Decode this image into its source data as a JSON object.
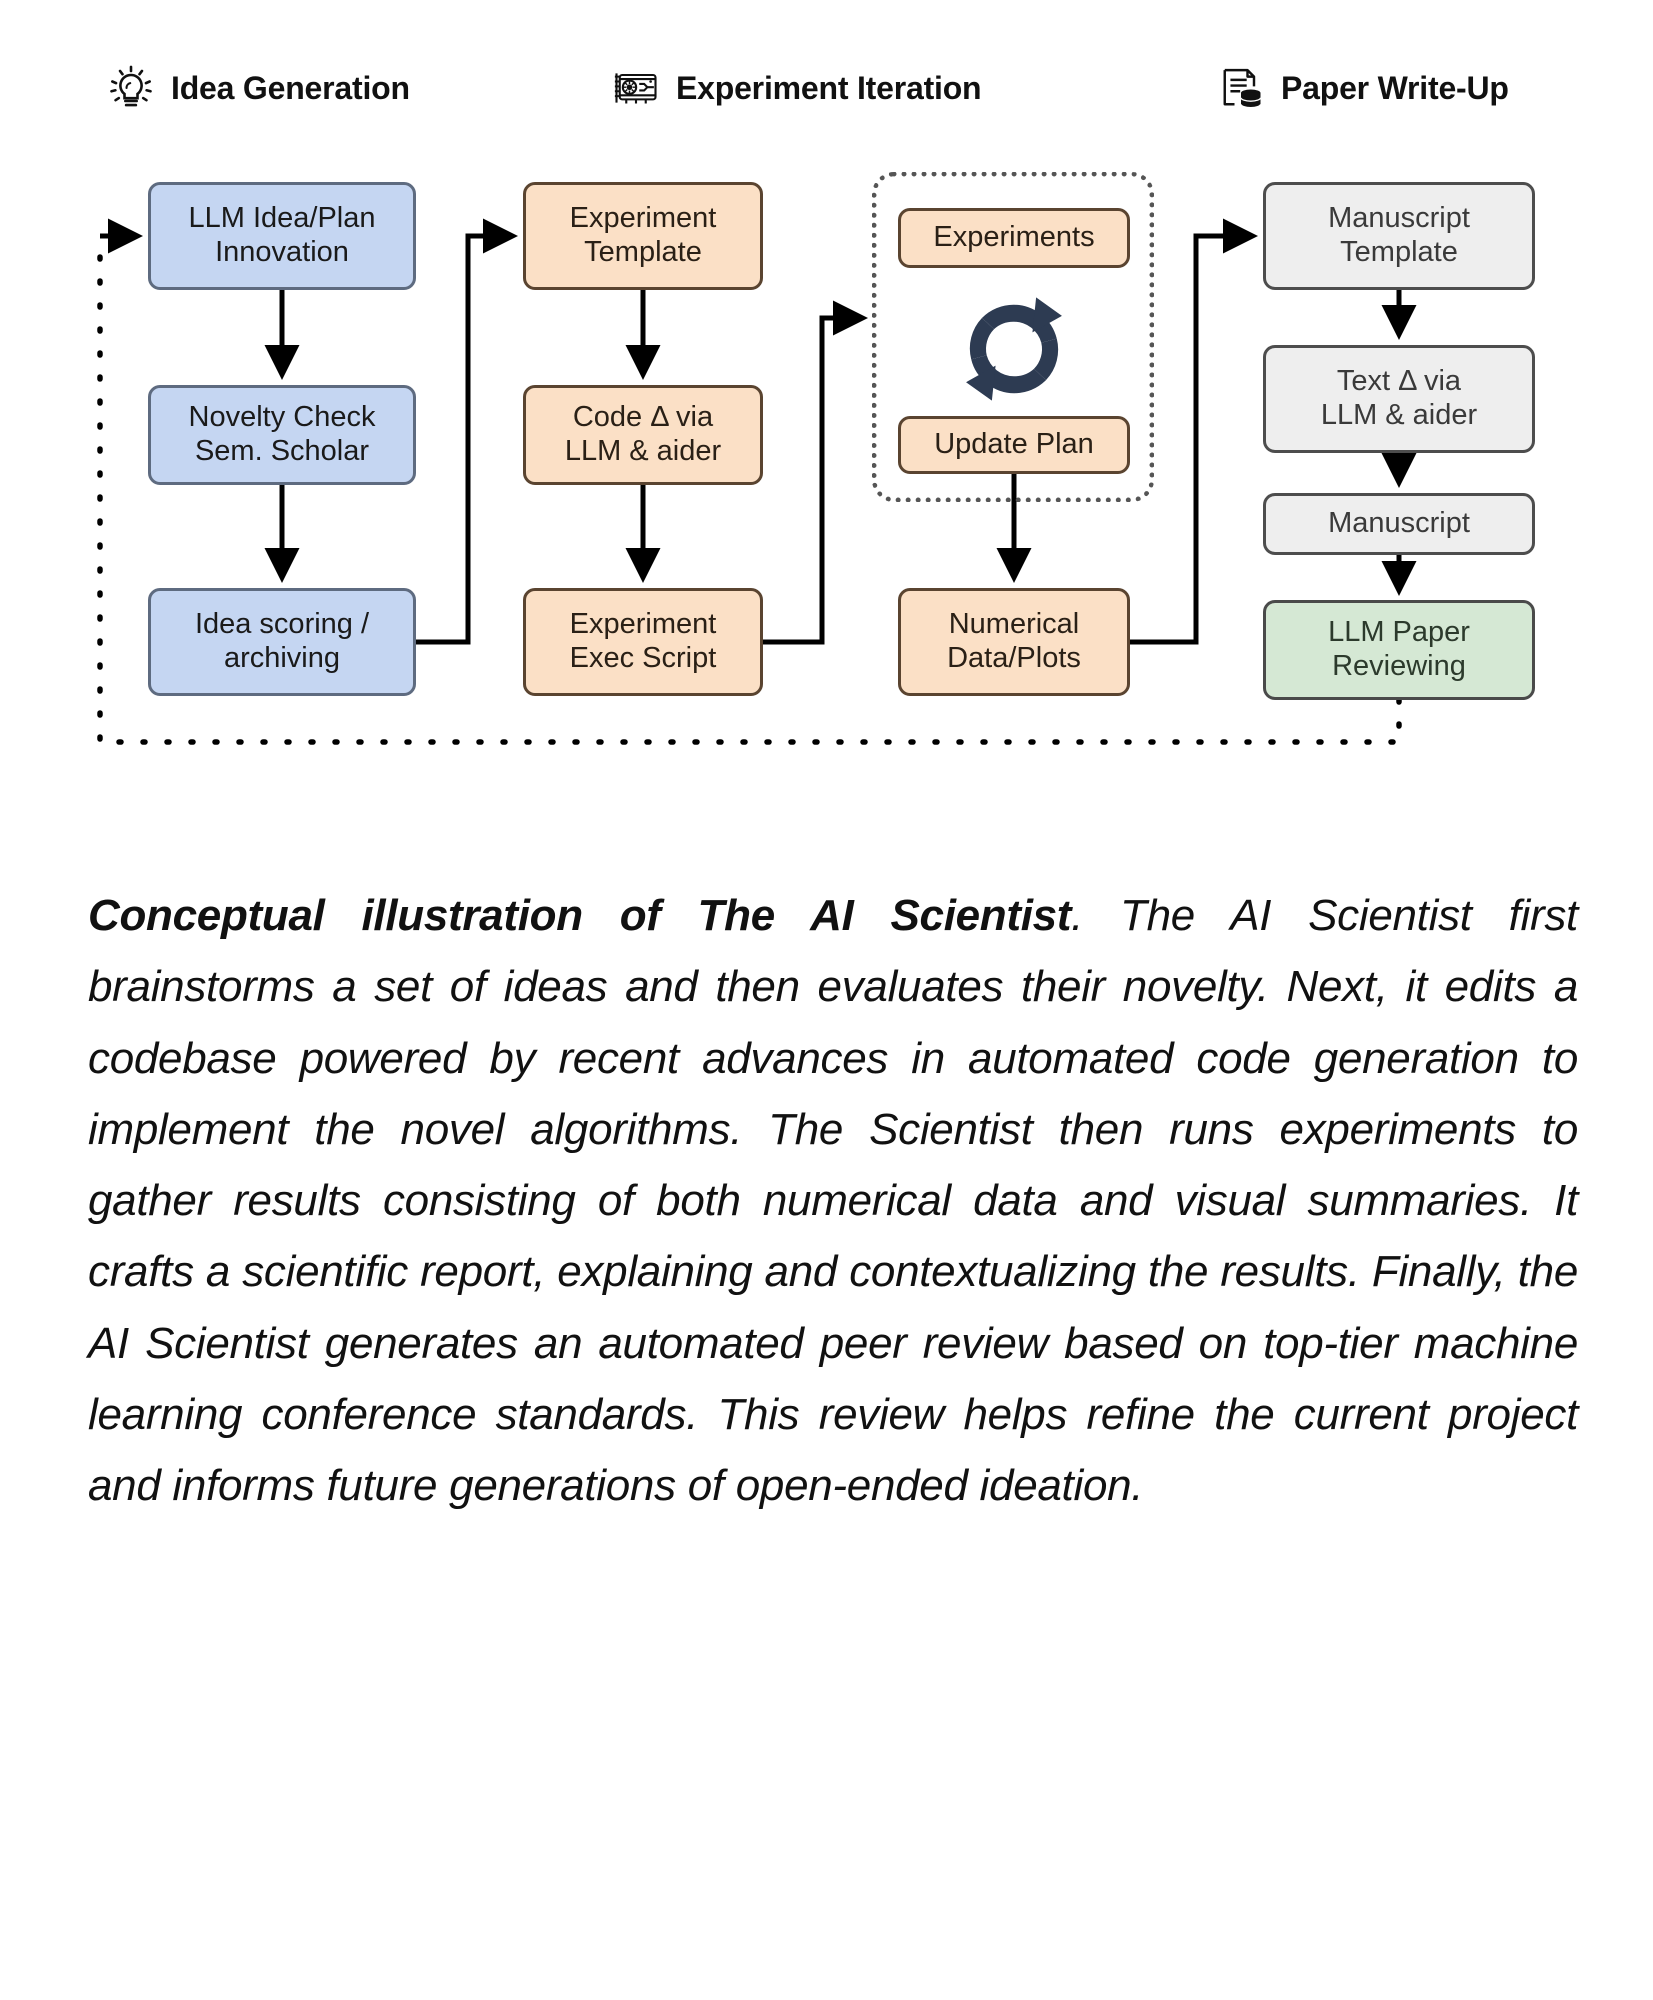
{
  "figure": {
    "sections": [
      {
        "id": "idea-generation",
        "label": "Idea Generation",
        "icon": "lightbulb-icon"
      },
      {
        "id": "experiment-iteration",
        "label": "Experiment Iteration",
        "icon": "gpu-card-icon"
      },
      {
        "id": "paper-write-up",
        "label": "Paper Write-Up",
        "icon": "document-database-icon"
      }
    ],
    "nodes": {
      "llm_idea_plan": {
        "line1": "LLM Idea/Plan",
        "line2": "Innovation",
        "color": "#c5d6f2"
      },
      "novelty_check": {
        "line1": "Novelty Check",
        "line2": "Sem. Scholar",
        "color": "#c5d6f2"
      },
      "idea_scoring": {
        "line1": "Idea scoring /",
        "line2": "archiving",
        "color": "#c5d6f2"
      },
      "experiment_template": {
        "line1": "Experiment",
        "line2": "Template",
        "color": "#fbe0c6"
      },
      "code_delta": {
        "line1": "Code Δ via",
        "line2": "LLM & aider",
        "color": "#fbe0c6"
      },
      "experiment_exec": {
        "line1": "Experiment",
        "line2": "Exec Script",
        "color": "#fbe0c6"
      },
      "experiments": {
        "line1": "Experiments",
        "line2": "",
        "color": "#fbe0c6"
      },
      "update_plan": {
        "line1": "Update Plan",
        "line2": "",
        "color": "#fbe0c6"
      },
      "numerical_data": {
        "line1": "Numerical",
        "line2": "Data/Plots",
        "color": "#fbe0c6"
      },
      "manuscript_template": {
        "line1": "Manuscript",
        "line2": "Template",
        "color": "#eeeeee"
      },
      "text_delta": {
        "line1": "Text Δ via",
        "line2": "LLM & aider",
        "color": "#eeeeee"
      },
      "manuscript": {
        "line1": "Manuscript",
        "line2": "",
        "color": "#eeeeee"
      },
      "llm_paper_review": {
        "line1": "LLM Paper",
        "line2": "Reviewing",
        "color": "#d5e8d4"
      }
    },
    "loop_icon": "refresh-cycle-icon",
    "loop_icon_color": "#2d3b52"
  },
  "caption": {
    "lead": "Conceptual illustration of The AI Scientist",
    "body": ". The AI Scientist first brainstorms a set of ideas and then evaluates their novelty. Next, it edits a codebase powered by recent advances in automated code generation to implement the novel algorithms. The Scientist then runs experiments to gather results consisting of both numerical data and visual summaries. It crafts a scientific report, explaining and contextualizing the results. Finally, the AI Scientist generates an automated peer review based on top-tier machine learning conference standards. This review helps refine the current project and informs future generations of open-ended ideation."
  }
}
